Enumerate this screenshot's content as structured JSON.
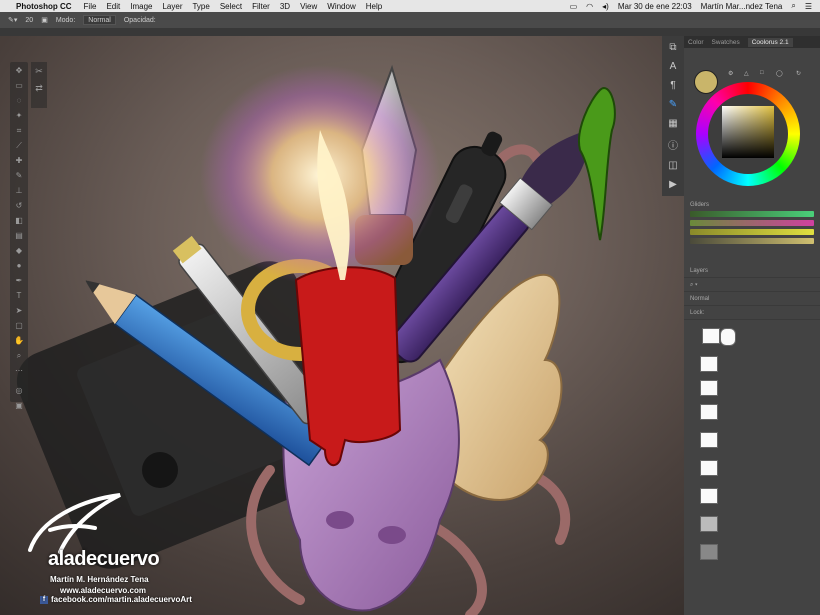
{
  "menubar": {
    "app_name": "Photoshop CC",
    "items": [
      "File",
      "Edit",
      "Image",
      "Layer",
      "Type",
      "Select",
      "Filter",
      "3D",
      "View",
      "Window",
      "Help"
    ],
    "clock": "Mar 30 de ene 22:03",
    "user": "Martín Mar...ndez Tena"
  },
  "options": {
    "size": "20",
    "mode_label": "Modo:",
    "mode_value": "Normal",
    "opacity_label": "Opacidad:"
  },
  "panel": {
    "color_tabs": [
      "Color",
      "Swatches",
      "Coolorus 2.1"
    ],
    "gliders_label": "Gliders",
    "layers_tab": "Layers",
    "blend_mode": "Normal",
    "lock_label": "Lock:"
  },
  "watermark": {
    "brand": "aladecuervo",
    "author": "Martín M. Hernández Tena",
    "website": "www.aladecuervo.com",
    "facebook": "facebook.com/martin.aladecuervoArt"
  },
  "colors": {
    "accent": "#4aa3ff",
    "foreground_color": "#c9b56a"
  }
}
